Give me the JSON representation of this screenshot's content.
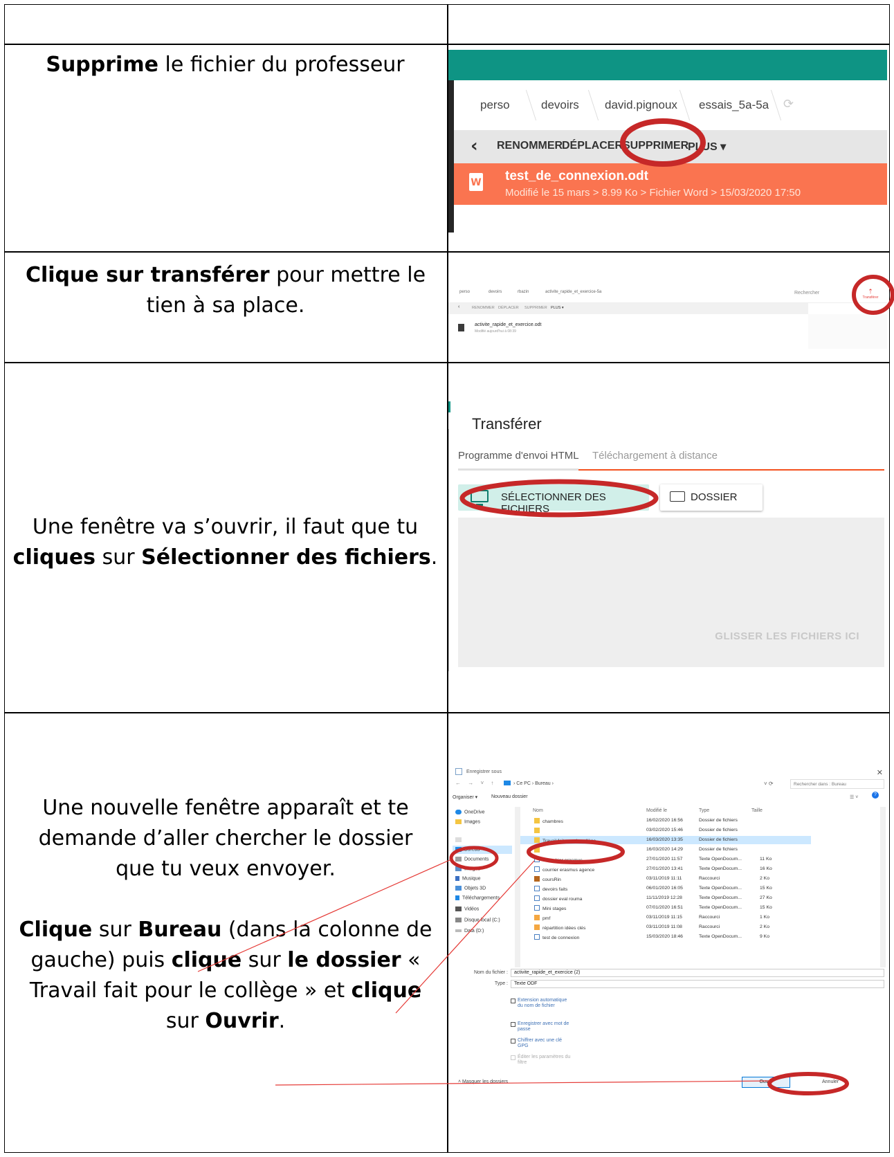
{
  "colors": {
    "accent_teal": "#0e9484",
    "file_orange": "#fa7450",
    "annotation_red": "#c62828",
    "transfer_red": "#e53935"
  },
  "rows": [
    {
      "bold_prefix": "Supprime",
      "text": " le fichier du professeur"
    },
    {
      "bold_prefix": "Clique sur transférer",
      "text": " pour mettre le tien à sa place."
    },
    {
      "line1": "Une fenêtre va s’ouvrir, il faut que tu",
      "bold_a": "cliques",
      "mid": " sur ",
      "bold_b": "Sélectionner des fichiers",
      "end": "."
    },
    {
      "para1": "Une nouvelle fenêtre apparaît et te demande d’aller chercher le dossier que tu veux envoyer.",
      "b1": "Clique",
      "t1": " sur ",
      "b2": "Bureau",
      "t2": " (dans la colonne de gauche) puis ",
      "b3": "clique",
      "t3": " sur ",
      "b4": "le dossier",
      "t4": " « Travail fait pour le collège » et ",
      "b5": "clique",
      "t5": " sur ",
      "b6": "Ouvrir",
      "t6": "."
    }
  ],
  "shot1": {
    "breadcrumbs": [
      "perso",
      "devoirs",
      "david.pignoux",
      "essais_5a-5a"
    ],
    "toolbar": [
      "RENOMMER",
      "DÉPLACER",
      "SUPPRIMER",
      "PLUS ▾"
    ],
    "file_name": "test_de_connexion.odt",
    "file_meta": "Modifié le 15 mars  >  8.99 Ko  >  Fichier Word  >  15/03/2020 17:50",
    "refresh_icon": "refresh-icon",
    "back_icon": "chevron-left-icon"
  },
  "shot2": {
    "breadcrumbs": [
      "perso",
      "devoirs",
      "rbazin",
      "activite_rapide_et_exercice-5a"
    ],
    "toolbar": [
      "RENOMMER",
      "DÉPLACER",
      "SUPPRIMER",
      "PLUS ▾"
    ],
    "search": "Rechercher",
    "transfer_label": "Transférer",
    "file_name": "activite_rapide_et_exercice.odt",
    "file_meta": "Modifié aujourd'hui à 08:39"
  },
  "shot3": {
    "title": "Transférer",
    "tabs": [
      "Programme d'envoi HTML",
      "Téléchargement à distance"
    ],
    "select_button": "SÉLECTIONNER DES FICHIERS",
    "folder_button": "DOSSIER",
    "drop_hint": "GLISSER LES FICHIERS ICI"
  },
  "shot4": {
    "window_title": "Enregistrer sous",
    "path": "›  Ce PC  ›  Bureau  ›",
    "search_placeholder": "Rechercher dans : Bureau",
    "organize": "Organiser ▾",
    "new_folder": "Nouveau dossier",
    "nav_items": [
      "OneDrive",
      "Images",
      "",
      "Bureau",
      "Documents",
      "Images",
      "Musique",
      "Objets 3D",
      "Téléchargements",
      "Vidéos",
      "Disque local (C:)",
      "Data (D:)"
    ],
    "columns": [
      "Nom",
      "Modifié le",
      "Type",
      "Taille"
    ],
    "rows": [
      {
        "name": "chambres",
        "date": "16/02/2020 16:56",
        "type": "Dossier de fichiers",
        "size": ""
      },
      {
        "name": "",
        "date": "03/02/2020 15:46",
        "type": "Dossier de fichiers",
        "size": ""
      },
      {
        "name": "Travail fait pour le collège",
        "date": "16/03/2020 13:35",
        "type": "Dossier de fichiers",
        "size": ""
      },
      {
        "name": "",
        "date": "16/03/2020 14:29",
        "type": "Dossier de fichiers",
        "size": ""
      },
      {
        "name": "calendrier erasmus",
        "date": "27/01/2020 11:57",
        "type": "Texte OpenDocum...",
        "size": "11 Ko"
      },
      {
        "name": "courrier erasmus agence",
        "date": "27/01/2020 13:41",
        "type": "Texte OpenDocum...",
        "size": "16 Ko"
      },
      {
        "name": "coursRin",
        "date": "03/11/2019 11:11",
        "type": "Raccourci",
        "size": "2 Ko"
      },
      {
        "name": "devoirs faits",
        "date": "06/01/2020 16:05",
        "type": "Texte OpenDocum...",
        "size": "15 Ko"
      },
      {
        "name": "dossier eval rouma",
        "date": "11/11/2019 12:28",
        "type": "Texte OpenDocum...",
        "size": "27 Ko"
      },
      {
        "name": "Mini stages",
        "date": "07/01/2020 16:51",
        "type": "Texte OpenDocum...",
        "size": "15 Ko"
      },
      {
        "name": "pmf",
        "date": "03/11/2019 11:15",
        "type": "Raccourci",
        "size": "1 Ko"
      },
      {
        "name": "répartition idées clés",
        "date": "03/11/2019 11:08",
        "type": "Raccourci",
        "size": "2 Ko"
      },
      {
        "name": "test de connexion",
        "date": "15/03/2020 18:46",
        "type": "Texte OpenDocum...",
        "size": "9 Ko"
      }
    ],
    "filename_label": "Nom du fichier :",
    "filename_value": "activite_rapide_et_exercice (2)",
    "type_label": "Type :",
    "type_value": "Texte ODF",
    "options": [
      "Extension automatique du nom de fichier",
      "Enregistrer avec mot de passe",
      "Chiffrer avec une clé GPG",
      "Éditer les paramètres du filtre"
    ],
    "hide_folders": "˄ Masquer les dossiers",
    "open_button": "Ouvrir",
    "cancel_button": "Annuler"
  }
}
